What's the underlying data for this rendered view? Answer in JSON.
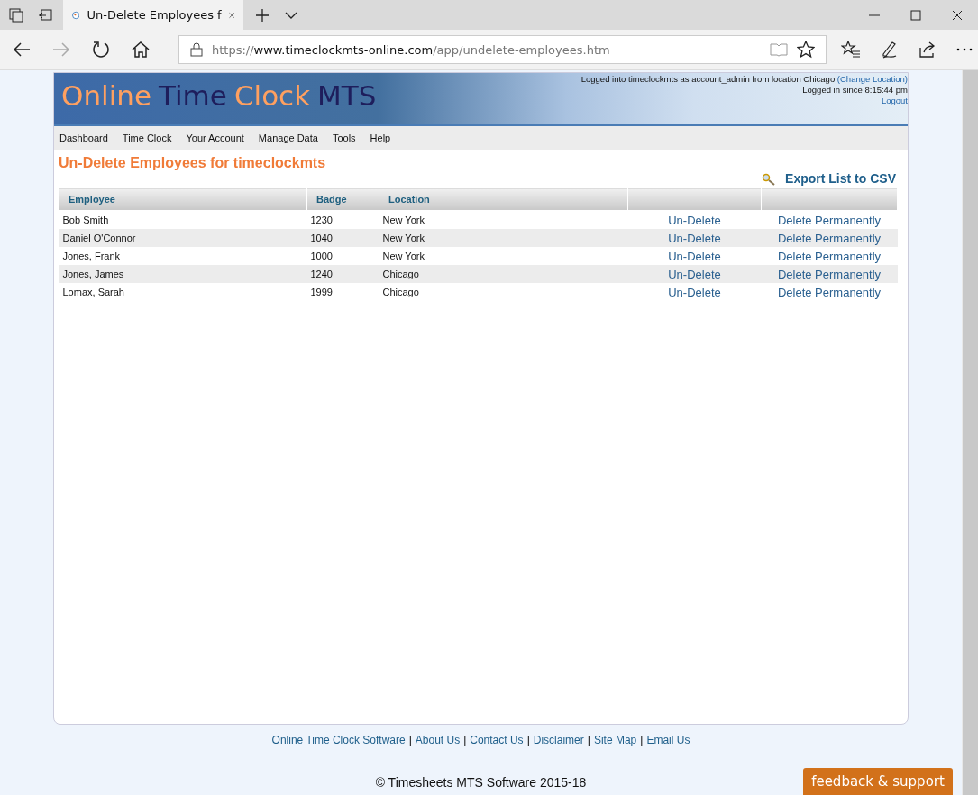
{
  "browser": {
    "tab_title": "Un-Delete Employees f",
    "url": {
      "scheme": "https://",
      "domain": "www.timeclockmts-online.com",
      "path": "/app/undelete-employees.htm"
    }
  },
  "header": {
    "logo": [
      {
        "text": "Online",
        "color": "#ffa060"
      },
      {
        "text": "Time",
        "color": "#1e1e5c"
      },
      {
        "text": "Clock",
        "color": "#ffa060"
      },
      {
        "text": "MTS",
        "color": "#1e1e5c"
      }
    ],
    "login_text": "Logged into timeclockmts as account_admin from location Chicago",
    "change_location": "(Change Location)",
    "since": "Logged in since 8:15:44 pm",
    "logout": "Logout"
  },
  "nav": [
    "Dashboard",
    "Time Clock",
    "Your Account",
    "Manage Data",
    "Tools",
    "Help"
  ],
  "title": "Un-Delete Employees for timeclockmts",
  "export": "Export List to CSV",
  "table": {
    "columns": [
      "Employee",
      "Badge",
      "Location"
    ],
    "rows": [
      {
        "employee": "Bob Smith",
        "badge": "1230",
        "location": "New York",
        "undelete": "Un-Delete",
        "delete": "Delete Permanently"
      },
      {
        "employee": "Daniel O'Connor",
        "badge": "1040",
        "location": "New York",
        "undelete": "Un-Delete",
        "delete": "Delete Permanently"
      },
      {
        "employee": "Jones, Frank",
        "badge": "1000",
        "location": "New York",
        "undelete": "Un-Delete",
        "delete": "Delete Permanently"
      },
      {
        "employee": "Jones, James",
        "badge": "1240",
        "location": "Chicago",
        "undelete": "Un-Delete",
        "delete": "Delete Permanently"
      },
      {
        "employee": "Lomax, Sarah",
        "badge": "1999",
        "location": "Chicago",
        "undelete": "Un-Delete",
        "delete": "Delete Permanently"
      }
    ]
  },
  "footer": {
    "links": [
      "Online Time Clock Software",
      "About Us",
      "Contact Us",
      "Disclaimer",
      "Site Map",
      "Email Us"
    ],
    "separator": "|",
    "copyright": "© Timesheets MTS Software 2015-18"
  },
  "feedback": "feedback & support"
}
